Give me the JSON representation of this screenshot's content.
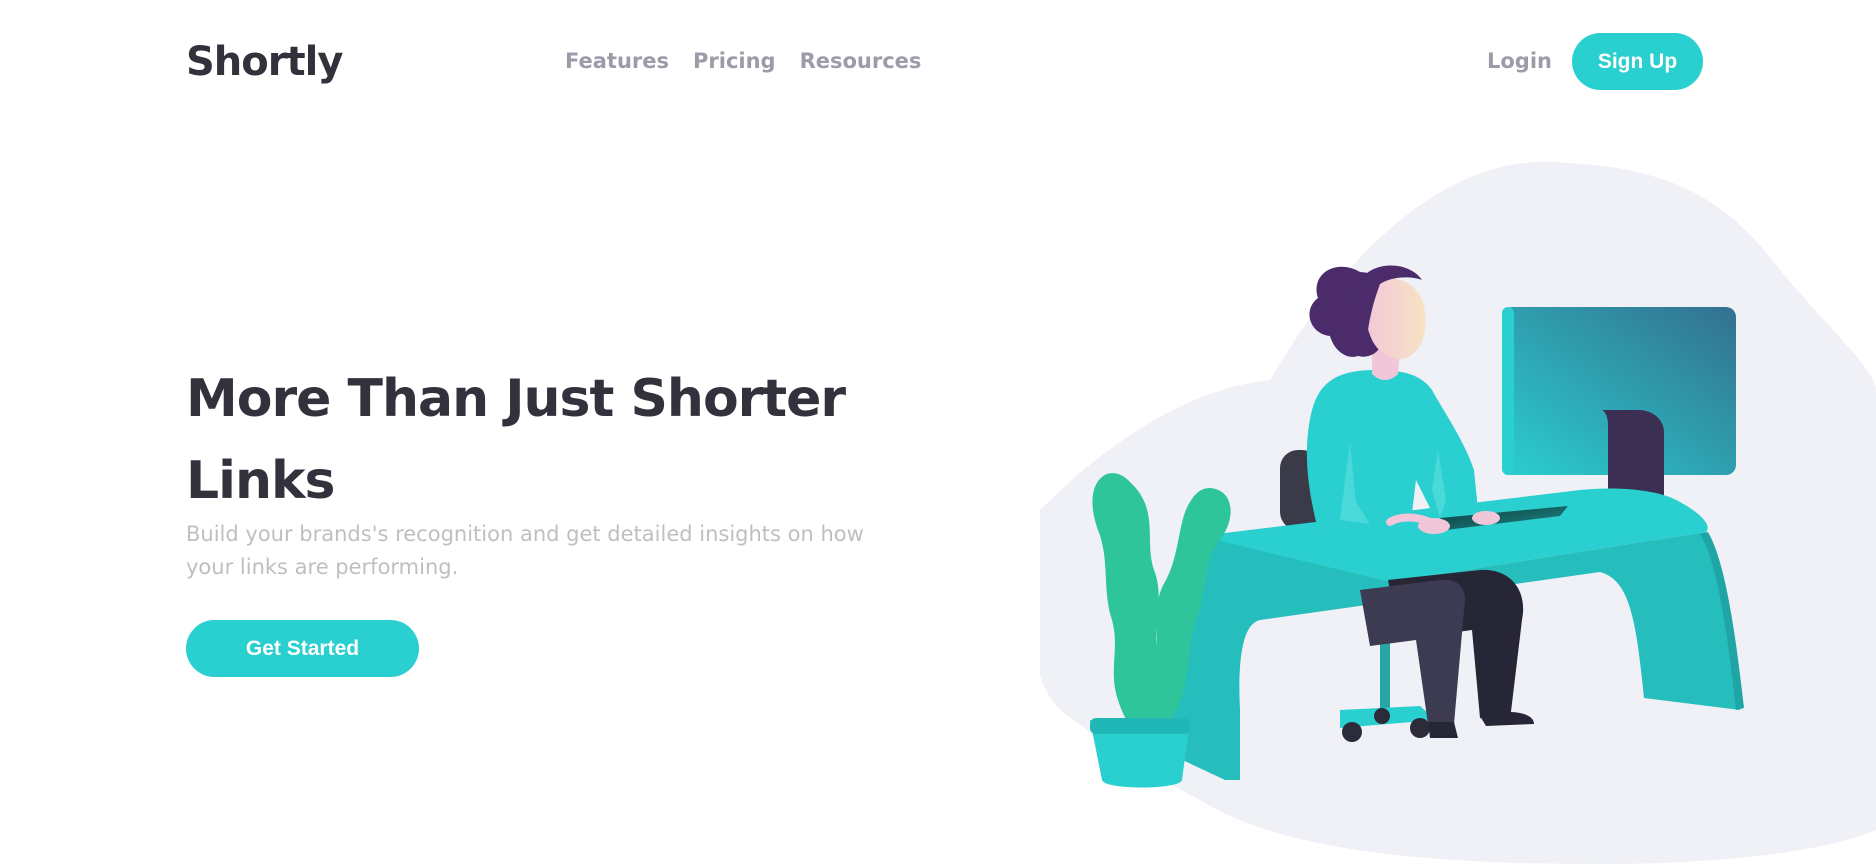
{
  "header": {
    "logo": "Shortly",
    "nav": [
      {
        "label": "Features"
      },
      {
        "label": "Pricing"
      },
      {
        "label": "Resources"
      }
    ],
    "login_label": "Login",
    "signup_label": "Sign Up"
  },
  "hero": {
    "title": "More Than Just Shorter Links",
    "subtitle": "Build your brands's recognition and get detailed insights on how your links are performing.",
    "cta_label": "Get Started"
  },
  "colors": {
    "accent": "#2acfcf",
    "dark_text": "#34313d",
    "muted_text": "#9e9aa8",
    "light_text": "#bfbfbf",
    "illustration_bg": "#f0f1f6"
  },
  "icons": [
    "working-illustration"
  ]
}
